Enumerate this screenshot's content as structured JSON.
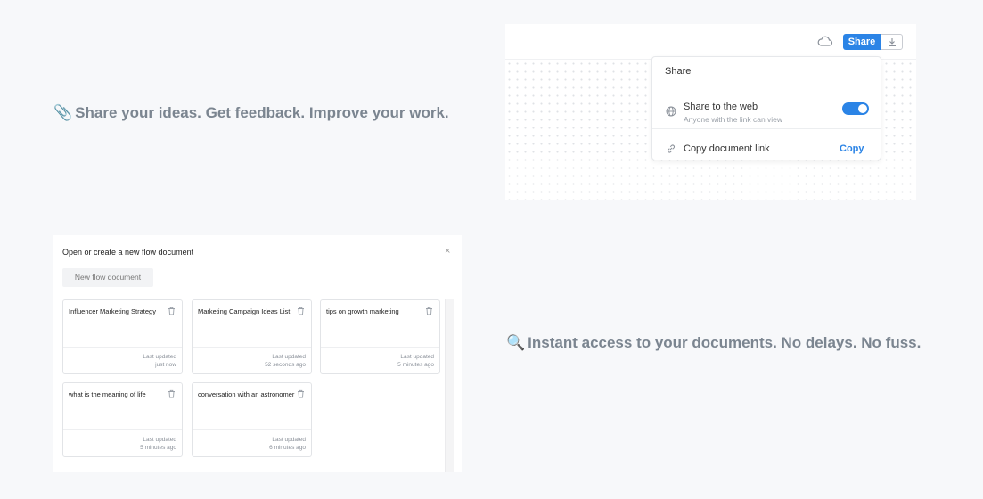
{
  "features": [
    {
      "emoji": "📎",
      "text": "Share your ideas. Get feedback. Improve your work."
    },
    {
      "emoji": "🔍",
      "text": "Instant access to your documents. No delays. No fuss."
    }
  ],
  "share_panel": {
    "share_button": "Share",
    "popover_title": "Share",
    "web": {
      "title": "Share to the web",
      "subtitle": "Anyone with the link can view",
      "enabled": true
    },
    "copy": {
      "label": "Copy document link",
      "action": "Copy"
    },
    "accent_color": "#2b84e6"
  },
  "docs_dialog": {
    "title": "Open or create a new flow document",
    "close": "×",
    "new_button": "New flow document",
    "documents": [
      {
        "name": "Influencer Marketing Strategy",
        "updated_label": "Last updated",
        "updated": "just now"
      },
      {
        "name": "Marketing Campaign Ideas List",
        "updated_label": "Last updated",
        "updated": "52 seconds ago"
      },
      {
        "name": "tips on growth marketing",
        "updated_label": "Last updated",
        "updated": "5 minutes ago"
      },
      {
        "name": "what is the meaning of life",
        "updated_label": "Last updated",
        "updated": "5 minutes ago"
      },
      {
        "name": "conversation with an astronomer",
        "updated_label": "Last updated",
        "updated": "6 minutes ago"
      }
    ]
  }
}
